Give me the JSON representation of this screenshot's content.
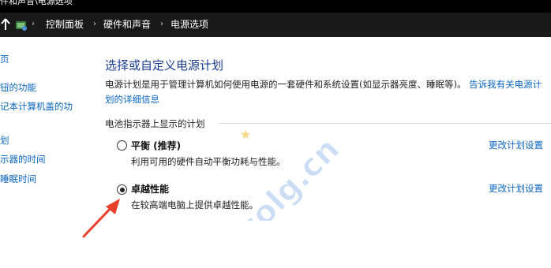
{
  "window": {
    "title": "件和声音\\电源选项"
  },
  "address_bar": {
    "crumbs": [
      "控制面板",
      "硬件和声音",
      "电源选项"
    ]
  },
  "sidebar": {
    "items": [
      "页",
      "钮的功能",
      "记本计算机盖的功",
      "划",
      "示器的时间",
      "睡眠时间"
    ]
  },
  "main": {
    "title": "选择或自定义电源计划",
    "description_text": "电源计划是用于管理计算机如何使用电源的一套硬件和系统设置(如显示器亮度、睡眠等)。",
    "description_link_1": "告诉我有关电源计",
    "description_link_2": "划的详细信息",
    "section_label": "电池指示器上显示的计划",
    "plans": [
      {
        "name": "平衡 (推荐)",
        "desc": "利用可用的硬件自动平衡功耗与性能。",
        "change": "更改计划设置",
        "selected": false
      },
      {
        "name": "卓越性能",
        "desc": "在较高端电脑上提供卓越性能。",
        "change": "更改计划设置",
        "selected": true
      }
    ]
  },
  "watermark": {
    "text": "colg.cn"
  },
  "colors": {
    "link": "#0a66c2",
    "title": "#1a3d8f",
    "arrow": "#e8402a",
    "watermark": "#3f86d6"
  }
}
